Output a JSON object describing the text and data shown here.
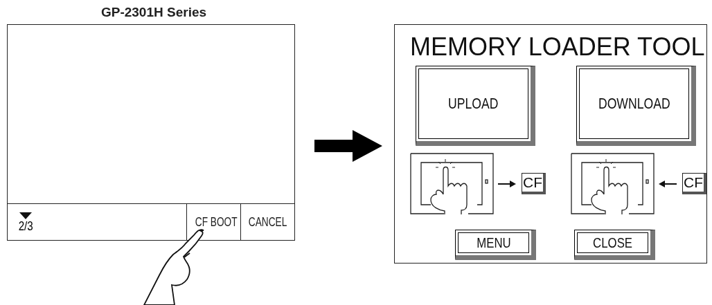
{
  "caption": "GP-2301H Series",
  "device_screen": {
    "page_indicator": "2/3",
    "buttons": [
      {
        "label": "CF BOOT"
      },
      {
        "label": "CANCEL"
      }
    ]
  },
  "memory_loader_screen": {
    "title": "MEMORY LOADER TOOL",
    "actions": [
      {
        "label": "UPLOAD",
        "kind": "upload",
        "card_label": "CF"
      },
      {
        "label": "DOWNLOAD",
        "kind": "download",
        "card_label": "CF"
      }
    ],
    "buttons": [
      "MENU",
      "CLOSE"
    ]
  }
}
